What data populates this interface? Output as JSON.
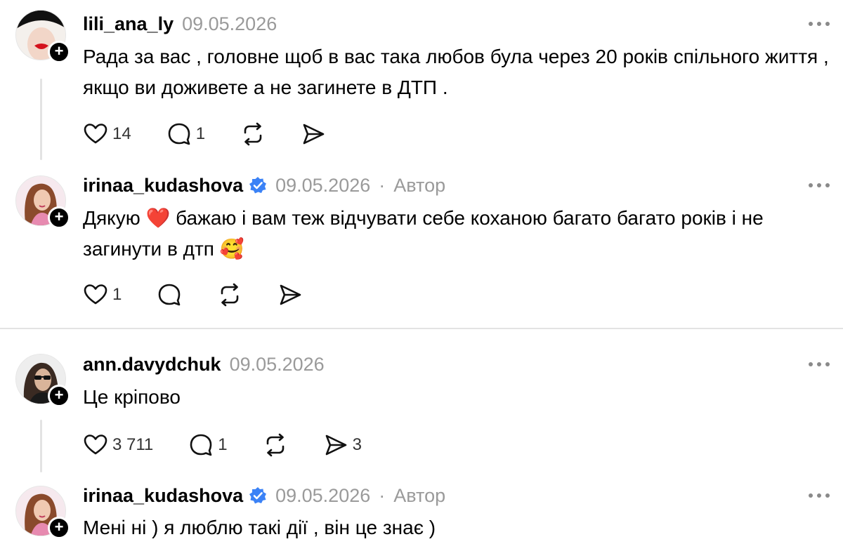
{
  "icons": {
    "follow": "plus-icon",
    "verified": "verified-badge-icon",
    "like": "heart-outline-icon",
    "reply": "comment-bubble-icon",
    "repost": "repost-arrows-icon",
    "share": "send-icon",
    "more": "more-dots-icon"
  },
  "colors": {
    "verified": "#3b82f6",
    "muted": "#9a9a9a"
  },
  "follow_symbol": "+",
  "posts": [
    {
      "username": "lili_ana_ly",
      "date": "09.05.2026",
      "text": "Рада за вас , головне щоб в вас така любов була через 20 років спільного життя , якщо ви доживете а не загинете в ДТП .",
      "likes": "14",
      "replies": "1",
      "reposts": "",
      "shares": ""
    },
    {
      "username": "irinaa_kudashova",
      "verified": true,
      "date": "09.05.2026",
      "separator": "·",
      "author_label": "Автор",
      "text_before_heart": "Дякую ",
      "heart_emoji": "❤️",
      "text_after_heart": " бажаю і вам теж відчувати себе коханою багато багато років і не загинути в дтп ",
      "love_emoji": "🥰",
      "likes": "1",
      "replies": "",
      "reposts": "",
      "shares": ""
    },
    {
      "username": "ann.davydchuk",
      "date": "09.05.2026",
      "text": "Це кріпово",
      "likes": "3 711",
      "replies": "1",
      "reposts": "",
      "shares": "3"
    },
    {
      "username": "irinaa_kudashova",
      "verified": true,
      "date": "09.05.2026",
      "separator": "·",
      "author_label": "Автор",
      "text": "Мені ні ) я люблю такі дії , він це знає )"
    }
  ]
}
